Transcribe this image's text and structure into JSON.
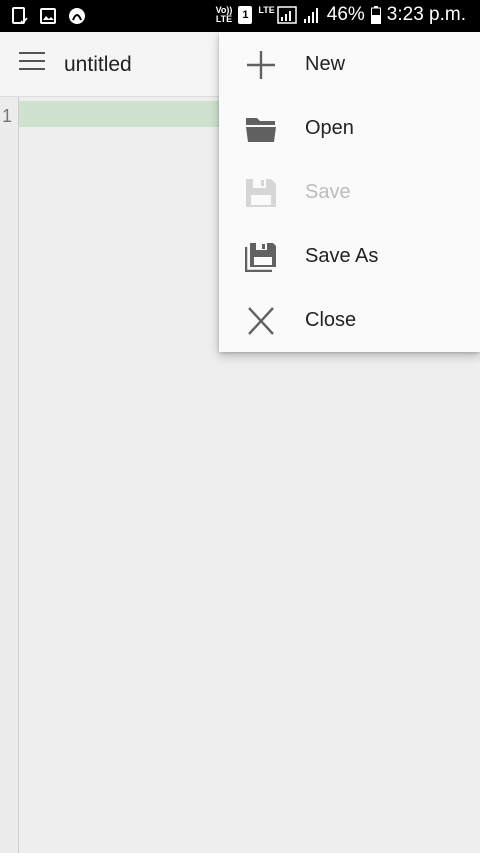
{
  "status_bar": {
    "volte_top": "Vo))",
    "volte_bottom": "LTE",
    "sim": "1",
    "lte_top": "LTE",
    "battery_percent": "46%",
    "time": "3:23 p.m."
  },
  "app_bar": {
    "title": "untitled"
  },
  "editor": {
    "line_numbers": [
      "1"
    ]
  },
  "menu": {
    "items": [
      {
        "label": "New",
        "icon": "plus-icon",
        "enabled": true
      },
      {
        "label": "Open",
        "icon": "folder-open-icon",
        "enabled": true
      },
      {
        "label": "Save",
        "icon": "floppy-disk-icon",
        "enabled": false
      },
      {
        "label": "Save As",
        "icon": "floppy-multiple-icon",
        "enabled": true
      },
      {
        "label": "Close",
        "icon": "close-icon",
        "enabled": true
      }
    ]
  },
  "colors": {
    "status_bar_bg": "#000000",
    "app_bar_bg": "#f5f5f5",
    "editor_bg": "#eeeeee",
    "current_line_highlight": "#cfe1cf",
    "menu_bg": "#fafafa",
    "icon_color": "#616161",
    "disabled_color": "#bdbdbd"
  }
}
